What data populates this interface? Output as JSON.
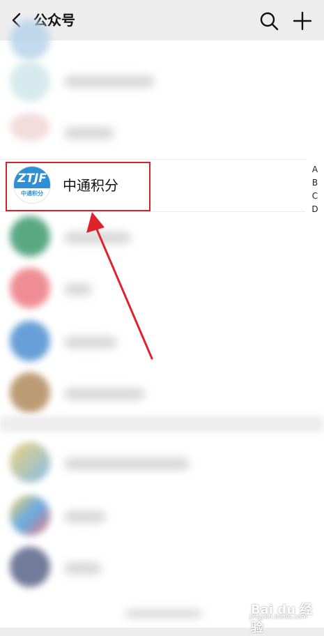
{
  "header": {
    "back_icon": "chevron-left-icon",
    "title": "公众号",
    "search_icon": "search-icon",
    "add_icon": "plus-icon"
  },
  "highlighted_account": {
    "logo_text": "ZTJF",
    "logo_subtext": "中通积分",
    "name": "中通积分",
    "logo_color": "#2d8fd5"
  },
  "index_letters": [
    "A",
    "B",
    "C",
    "D"
  ],
  "colors": {
    "highlight_border": "#d9202b",
    "arrow": "#e2222b",
    "background": "#ededed"
  },
  "watermark": {
    "text": "Bai du 经验",
    "url": "jingyan.baidu.com"
  }
}
